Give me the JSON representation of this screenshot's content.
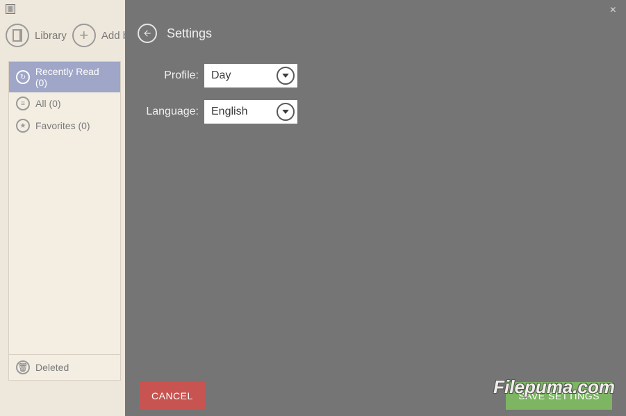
{
  "toolbar": {
    "library_label": "Library",
    "add_book_label": "Add bo"
  },
  "sidebar": {
    "items": [
      {
        "label": "Recently Read (0)",
        "icon": "↻",
        "active": true
      },
      {
        "label": "All (0)",
        "icon": "≡",
        "active": false
      },
      {
        "label": "Favorites (0)",
        "icon": "★",
        "active": false
      }
    ],
    "deleted_label": "Deleted"
  },
  "settings": {
    "title": "Settings",
    "close_glyph": "×",
    "profile_label": "Profile:",
    "profile_value": "Day",
    "language_label": "Language:",
    "language_value": "English",
    "cancel_label": "CANCEL",
    "save_label": "SAVE SETTINGS"
  },
  "watermark": "Filepuma.com"
}
